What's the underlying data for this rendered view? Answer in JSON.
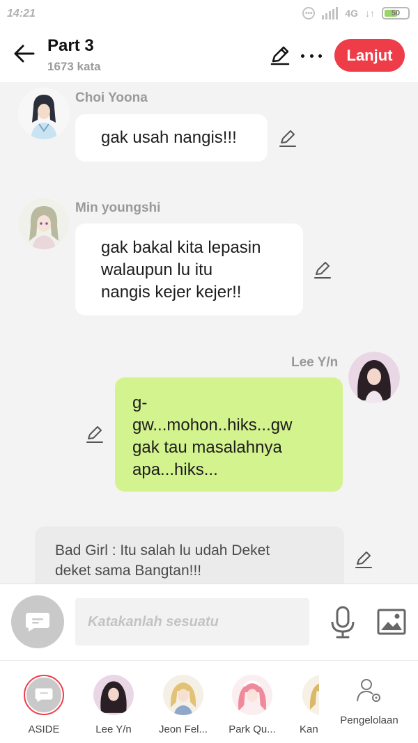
{
  "status_bar": {
    "time": "14:21",
    "network": "4G",
    "battery": "50"
  },
  "header": {
    "title": "Part 3",
    "word_count": "1673 kata",
    "next_label": "Lanjut"
  },
  "messages": [
    {
      "speaker": "Choi Yoona",
      "lines": [
        "gak usah nangis!!!"
      ]
    },
    {
      "speaker": "Min youngshi",
      "lines": [
        "gak bakal kita lepasin",
        "walaupun lu itu",
        "nangis kejer kejer!!"
      ]
    },
    {
      "speaker": "Lee Y/n",
      "lines": [
        "g-",
        "gw...mohon..hiks...gw",
        "gak tau masalahnya",
        "apa...hiks..."
      ]
    },
    {
      "speaker": "",
      "lines": [
        "Bad Girl : Itu salah lu udah Deket",
        "deket sama Bangtan!!!"
      ]
    }
  ],
  "input": {
    "placeholder": "Katakanlah sesuatu"
  },
  "characters": [
    {
      "label": "ASIDE"
    },
    {
      "label": "Lee Y/n"
    },
    {
      "label": "Jeon Fel..."
    },
    {
      "label": "Park Qu..."
    },
    {
      "label": "Kan"
    }
  ],
  "manage_label": "Pengelolaan",
  "colors": {
    "accent": "#ee3d48",
    "my_bubble": "#d3f38e",
    "background": "#f3f3f3"
  }
}
